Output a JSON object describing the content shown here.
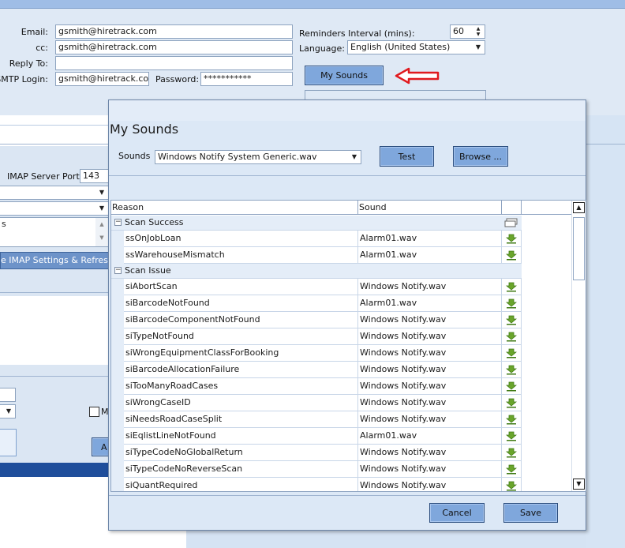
{
  "settings": {
    "email_label": "Email:",
    "email_value": "gsmith@hiretrack.com",
    "cc_label": "cc:",
    "cc_value": "gsmith@hiretrack.com",
    "reply_to_label": "Reply To:",
    "reply_to_value": "",
    "smtp_login_label": "SMTP Login:",
    "smtp_login_value": "gsmith@hiretrack.com",
    "password_label": "Password:",
    "password_value": "***********",
    "reminders_label": "Reminders Interval (mins):",
    "reminders_value": "60",
    "language_label": "Language:",
    "language_value": "English (United States)",
    "my_sounds_button": "My Sounds",
    "imap_port_label": "IMAP Server Port",
    "imap_port_value": "143",
    "list_fragment": "s",
    "imap_refresh_button_fragment": "e IMAP Settings & Refresh A",
    "checkbox_fragment": "M",
    "button_fragment": "A"
  },
  "dialog": {
    "title": "My Sounds",
    "sounds_label": "Sounds",
    "sounds_value": "Windows Notify System Generic.wav",
    "test_button": "Test",
    "browse_button": "Browse ...",
    "cancel_button": "Cancel",
    "save_button": "Save"
  },
  "grid": {
    "columns": [
      "Reason",
      "Sound"
    ],
    "groups": [
      {
        "name": "Scan Success",
        "rows": [
          {
            "reason": "ssOnJobLoan",
            "sound": "Alarm01.wav"
          },
          {
            "reason": "ssWarehouseMismatch",
            "sound": "Alarm01.wav"
          }
        ]
      },
      {
        "name": "Scan Issue",
        "rows": [
          {
            "reason": "siAbortScan",
            "sound": "Windows Notify.wav"
          },
          {
            "reason": "siBarcodeNotFound",
            "sound": "Alarm01.wav"
          },
          {
            "reason": "siBarcodeComponentNotFound",
            "sound": "Windows Notify.wav"
          },
          {
            "reason": "siTypeNotFound",
            "sound": "Windows Notify.wav"
          },
          {
            "reason": "siWrongEquipmentClassForBooking",
            "sound": "Windows Notify.wav"
          },
          {
            "reason": "siBarcodeAllocationFailure",
            "sound": "Windows Notify.wav"
          },
          {
            "reason": "siTooManyRoadCases",
            "sound": "Windows Notify.wav"
          },
          {
            "reason": "siWrongCaseID",
            "sound": "Windows Notify.wav"
          },
          {
            "reason": "siNeedsRoadCaseSplit",
            "sound": "Windows Notify.wav"
          },
          {
            "reason": "siEqlistLineNotFound",
            "sound": "Alarm01.wav"
          },
          {
            "reason": "siTypeCodeNoGlobalReturn",
            "sound": "Windows Notify.wav"
          },
          {
            "reason": "siTypeCodeNoReverseScan",
            "sound": "Windows Notify.wav"
          },
          {
            "reason": "siQuantRequired",
            "sound": "Windows Notify.wav"
          }
        ]
      }
    ]
  },
  "colors": {
    "button": "#7fa7dc",
    "dialog_bg": "#dce8f6",
    "arrow": "#e0191e",
    "download_icon": "#6aa52b"
  }
}
